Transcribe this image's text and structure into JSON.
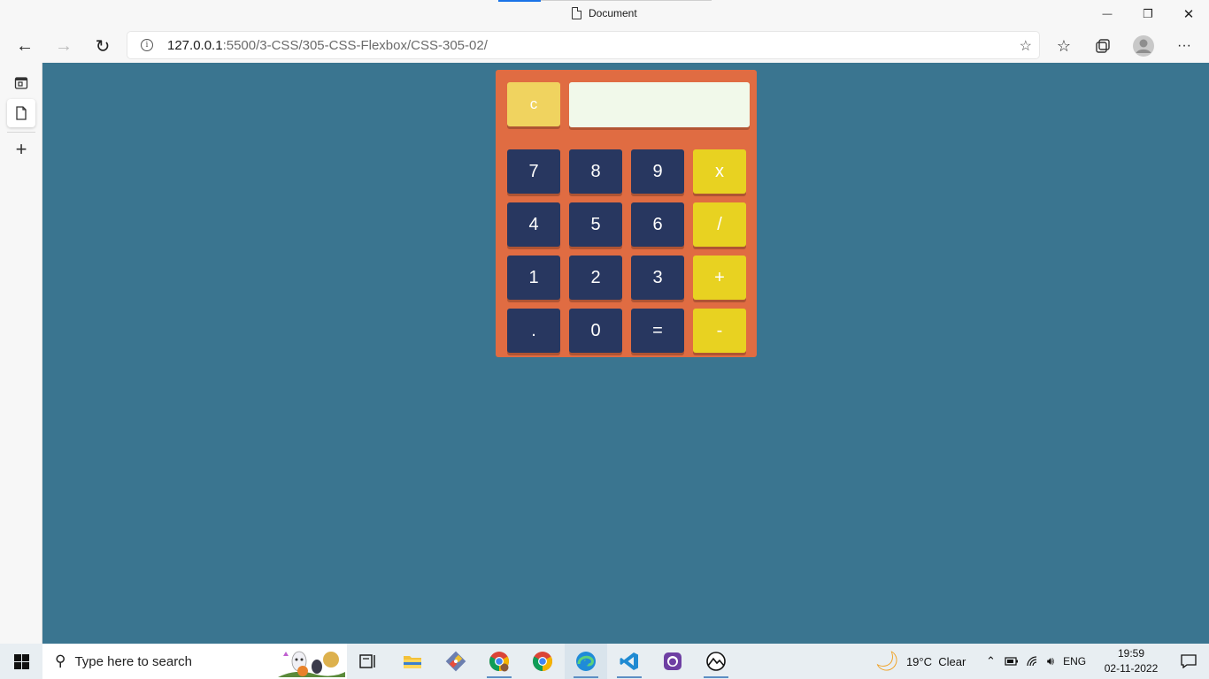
{
  "window": {
    "title": "Document",
    "minimize_glyph": "—",
    "restore_glyph": "❐",
    "close_glyph": "✕"
  },
  "navbar": {
    "back_glyph": "←",
    "forward_glyph": "→",
    "refresh_glyph": "↻",
    "url_host": "127.0.0.1",
    "url_rest": ":5500/3-CSS/305-CSS-Flexbox/CSS-305-02/",
    "add_favorite_glyph": "☆",
    "favorites_glyph": "☆",
    "more_glyph": "···"
  },
  "vertical_tabs": {
    "new_tab_glyph": "+"
  },
  "calculator": {
    "clear_label": "c",
    "display_value": "",
    "rows": [
      [
        {
          "label": "7",
          "kind": "num"
        },
        {
          "label": "8",
          "kind": "num"
        },
        {
          "label": "9",
          "kind": "num"
        },
        {
          "label": "x",
          "kind": "op"
        }
      ],
      [
        {
          "label": "4",
          "kind": "num"
        },
        {
          "label": "5",
          "kind": "num"
        },
        {
          "label": "6",
          "kind": "num"
        },
        {
          "label": "/",
          "kind": "op"
        }
      ],
      [
        {
          "label": "1",
          "kind": "num"
        },
        {
          "label": "2",
          "kind": "num"
        },
        {
          "label": "3",
          "kind": "num"
        },
        {
          "label": "+",
          "kind": "op"
        }
      ],
      [
        {
          "label": ".",
          "kind": "num"
        },
        {
          "label": "0",
          "kind": "num"
        },
        {
          "label": "=",
          "kind": "num"
        },
        {
          "label": "-",
          "kind": "op"
        }
      ]
    ],
    "colors": {
      "body": "#e06c42",
      "number_key": "#283760",
      "operator_key": "#e8d221",
      "clear_key": "#f0d35f",
      "display": "#f1f9ea",
      "page_background": "#3a7590"
    }
  },
  "taskbar": {
    "search_placeholder": "Type here to search",
    "weather": "19°C  Clear",
    "language": "ENG",
    "time": "19:59",
    "date": "02-11-2022",
    "apps": [
      "task-view",
      "file-explorer",
      "git",
      "chrome-profile",
      "chrome",
      "edge",
      "vscode",
      "github-desktop",
      "photos"
    ]
  }
}
